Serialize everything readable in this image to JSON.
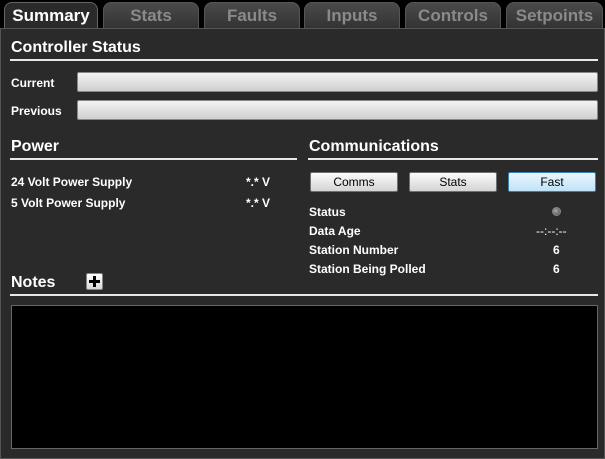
{
  "tabs": [
    {
      "label": "Summary",
      "active": true
    },
    {
      "label": "Stats"
    },
    {
      "label": "Faults"
    },
    {
      "label": "Inputs"
    },
    {
      "label": "Controls"
    },
    {
      "label": "Setpoints"
    }
  ],
  "controller_status": {
    "title": "Controller Status",
    "current_label": "Current",
    "current_value": "",
    "previous_label": "Previous",
    "previous_value": ""
  },
  "power": {
    "title": "Power",
    "rows": [
      {
        "label": "24 Volt Power Supply",
        "value": "*.* V"
      },
      {
        "label": "5 Volt Power Supply",
        "value": "*.* V"
      }
    ]
  },
  "communications": {
    "title": "Communications",
    "buttons": [
      "Comms",
      "Stats",
      "Fast"
    ],
    "rows": [
      {
        "label": "Status",
        "value": ""
      },
      {
        "label": "Data Age",
        "value": "--:--:--"
      },
      {
        "label": "Station Number",
        "value": "6"
      },
      {
        "label": "Station Being Polled",
        "value": "6"
      }
    ]
  },
  "notes": {
    "title": "Notes",
    "content": ""
  },
  "icons": {
    "add_note": "plus-icon",
    "status_indicator": "status-led-icon"
  },
  "colors": {
    "background": "#2a2a2a",
    "text": "#ffffff",
    "tab_inactive_text": "#8a8a8a",
    "focused_button": "#bfe3f8"
  }
}
